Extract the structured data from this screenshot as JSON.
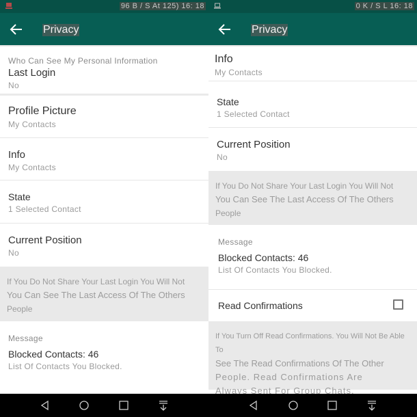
{
  "colors": {
    "appbar": "#075e54",
    "statusbar": "#075046",
    "note_bg": "#e9e9e9"
  },
  "left": {
    "status_text": "96 B / S At 125) 16: 18",
    "title": "Privacy",
    "section_header": "Who Can See My Personal Information",
    "items": [
      {
        "title": "Last Login",
        "subtitle": "No"
      },
      {
        "title": "Profile Picture",
        "subtitle": "My Contacts"
      },
      {
        "title": "Info",
        "subtitle": "My Contacts"
      },
      {
        "title": "State",
        "subtitle": "1 Selected Contact"
      },
      {
        "title": "Current Position",
        "subtitle": "No"
      }
    ],
    "note_line1": "If You Do Not Share Your Last Login You Will Not",
    "note_line2": "You Can See The Last Access Of The Others",
    "note_line3": "People",
    "message_header": "Message",
    "blocked": {
      "title": "Blocked Contacts: 46",
      "subtitle": "List Of Contacts You Blocked."
    }
  },
  "right": {
    "status_text": "0 K / S L 16: 18",
    "title": "Privacy",
    "items": [
      {
        "title": "Info",
        "subtitle": "My Contacts"
      },
      {
        "title": "State",
        "subtitle": "1 Selected Contact"
      },
      {
        "title": "Current Position",
        "subtitle": "No"
      }
    ],
    "note_line1": "If You Do Not Share Your Last Login You Will Not",
    "note_line2": "You Can See The Last Access Of The Others",
    "note_line3": "People",
    "message_header": "Message",
    "blocked": {
      "title": "Blocked Contacts: 46",
      "subtitle": "List Of Contacts You Blocked."
    },
    "read_confirmations": {
      "label": "Read Confirmations",
      "checked": false
    },
    "read_note_line1": "If You Turn Off Read Confirmations. You Will Not Be Able To",
    "read_note_line2": "See The Read Confirmations Of The Other",
    "read_note_line3": "People. Read Confirmations Are",
    "read_note_line4": "Always Sent For Group Chats."
  },
  "navbar": {
    "icons": [
      "back-triangle",
      "home-circle",
      "recents-square",
      "notification-pull-down"
    ]
  }
}
